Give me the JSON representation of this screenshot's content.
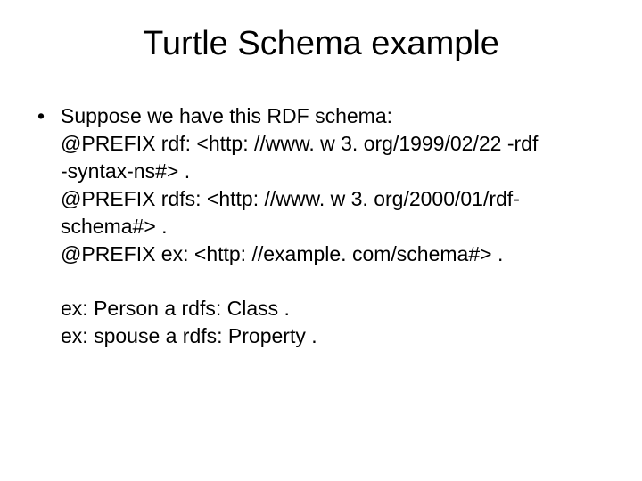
{
  "title": "Turtle Schema example",
  "bullet": "•",
  "intro": "Suppose we have this RDF schema:",
  "lines": {
    "l1": "@PREFIX rdf: <http: //www. w 3. org/1999/02/22 -rdf",
    "l2": "-syntax-ns#> .",
    "l3": "@PREFIX rdfs: <http: //www. w 3. org/2000/01/rdf-",
    "l4": "schema#> .",
    "l5": "@PREFIX ex: <http: //example. com/schema#> .",
    "l6": "ex: Person a rdfs: Class .",
    "l7": "ex: spouse a rdfs: Property ."
  }
}
